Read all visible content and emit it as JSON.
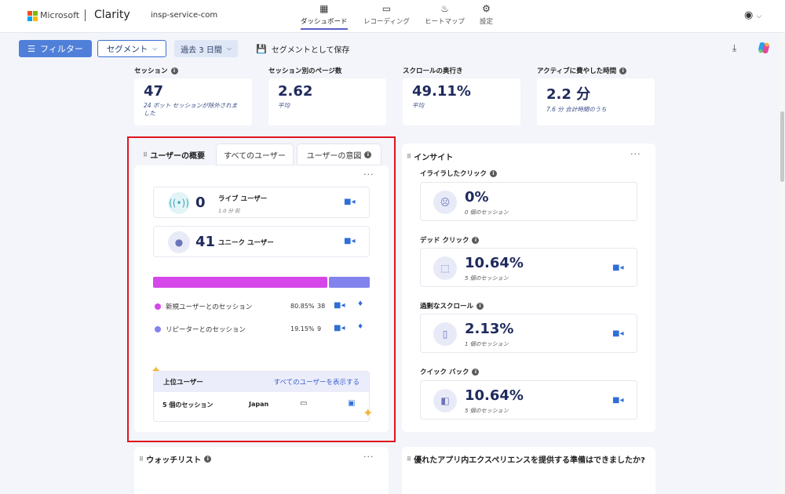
{
  "header": {
    "brand": "Microsoft",
    "app": "Clarity",
    "project": "insp-service-com",
    "nav": [
      {
        "label": "ダッシュボード",
        "icon": "dashboard-icon",
        "glyph": "▦"
      },
      {
        "label": "レコーディング",
        "icon": "recording-icon",
        "glyph": "▭"
      },
      {
        "label": "ヒートマップ",
        "icon": "heatmap-icon",
        "glyph": "♨"
      },
      {
        "label": "設定",
        "icon": "settings-icon",
        "glyph": "⚙"
      }
    ]
  },
  "toolbar": {
    "filter": "フィルター",
    "segment": "セグメント",
    "date_range": "過去 3 日間",
    "save_segment": "セグメントとして保存"
  },
  "metrics": [
    {
      "label": "セッション",
      "value": "47",
      "sub": "24 ボット セッションが除外されました",
      "info": true
    },
    {
      "label": "セッション別のページ数",
      "value": "2.62",
      "sub": "平均",
      "info": false
    },
    {
      "label": "スクロールの奥行き",
      "value": "49.11%",
      "sub": "平均",
      "info": false
    },
    {
      "label": "アクティブに費やした時間",
      "value": "2.2 分",
      "sub": "7.6 分 合計時間のうち",
      "info": true
    }
  ],
  "user_panel": {
    "tabs": [
      "ユーザーの概要",
      "すべてのユーザー",
      "ユーザーの意図"
    ],
    "live": {
      "value": "0",
      "label": "ライブ ユーザー",
      "sub": "1.0 分 前"
    },
    "unique": {
      "value": "41",
      "label": "ユニーク ユーザー"
    },
    "split": [
      {
        "label": "新規ユーザーとのセッション",
        "percent": "80.85%",
        "count": "38",
        "color": "#d547e8",
        "fraction": 0.8085
      },
      {
        "label": "リピーターとのセッション",
        "percent": "19.15%",
        "count": "9",
        "color": "#8283ec",
        "fraction": 0.1915
      }
    ],
    "top_users": {
      "title": "上位ユーザー",
      "link": "すべてのユーザーを表示する",
      "row": {
        "sessions": "5 個のセッション",
        "country": "Japan"
      }
    }
  },
  "insights": {
    "title": "インサイト",
    "items": [
      {
        "label": "イライラしたクリック",
        "value": "0%",
        "sub": "0 個のセッション",
        "icon": "frustrated-face-icon",
        "glyph": "☹",
        "has_video": false
      },
      {
        "label": "デッド クリック",
        "value": "10.64%",
        "sub": "5 個のセッション",
        "icon": "dead-click-icon",
        "glyph": "⬚",
        "has_video": true
      },
      {
        "label": "過剰なスクロール",
        "value": "2.13%",
        "sub": "1 個のセッション",
        "icon": "scroll-icon",
        "glyph": "▯",
        "has_video": true
      },
      {
        "label": "クイック バック",
        "value": "10.64%",
        "sub": "5 個のセッション",
        "icon": "quick-back-icon",
        "glyph": "◧",
        "has_video": true
      }
    ]
  },
  "bottom": {
    "watchlist": "ウォッチリスト",
    "survey": "優れたアプリ内エクスペリエンスを提供する準備はできましたか?"
  }
}
